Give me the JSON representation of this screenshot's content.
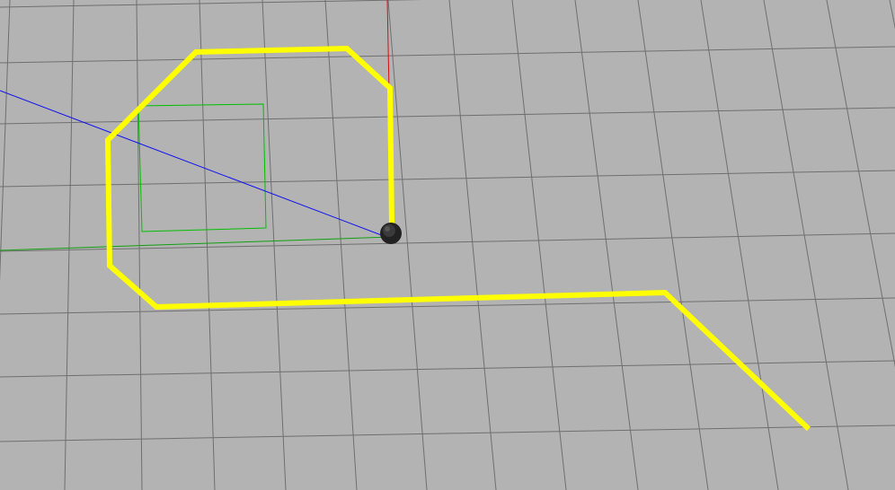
{
  "viewport": {
    "background_color": "#b3b3b3",
    "grid": {
      "visible": true,
      "line_color": "#6f6f6f"
    }
  },
  "axes": {
    "x_axis_color": "#d01010",
    "y_axis_color": "#10a010",
    "z_axis_color": "#1010ee"
  },
  "path": {
    "color": "#ffff00",
    "shape": "closed loop around the origin continuing into an outgoing diagonal tail"
  },
  "marker": {
    "color": "#00c000",
    "shape": "square"
  },
  "robot": {
    "icon": "robot-icon",
    "color": "#222222"
  }
}
